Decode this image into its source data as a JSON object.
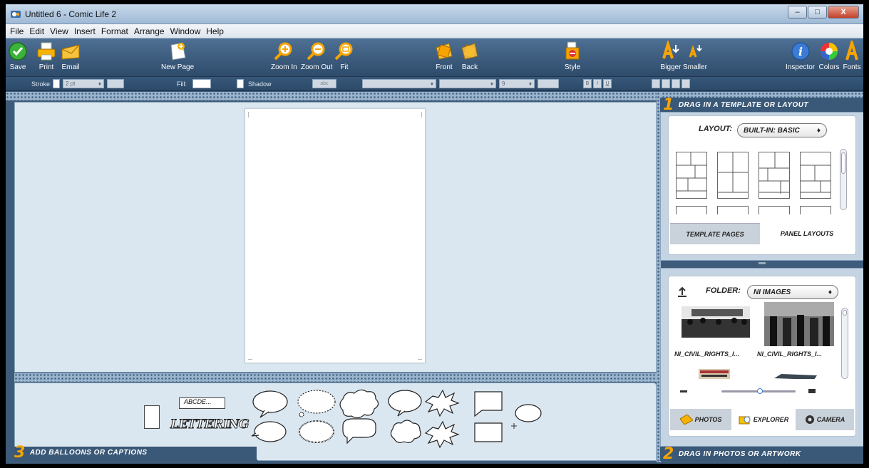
{
  "window": {
    "title": "Untitled 6 - Comic Life 2",
    "minimize": "–",
    "maximize": "□",
    "close": "X"
  },
  "menu": [
    "File",
    "Edit",
    "View",
    "Insert",
    "Format",
    "Arrange",
    "Window",
    "Help"
  ],
  "toolbar": {
    "save": "Save",
    "print": "Print",
    "email": "Email",
    "new_page": "New Page",
    "zoom_in": "Zoom In",
    "zoom_out": "Zoom Out",
    "fit": "Fit",
    "front": "Front",
    "back": "Back",
    "style": "Style",
    "bigger": "Bigger",
    "smaller": "Smaller",
    "inspector": "Inspector",
    "colors": "Colors",
    "fonts": "Fonts"
  },
  "formatbar": {
    "stroke_label": "Stroke:",
    "stroke_value": "2 pt",
    "fill_label": "Fill:",
    "shadow_label": "Shadow",
    "shadow_button": "abc",
    "font_size": "9",
    "bold": "B",
    "italic": "I",
    "underline": "U"
  },
  "panels": {
    "step1_number": "1",
    "step1_title": "DRAG IN A TEMPLATE OR LAYOUT",
    "step2_number": "2",
    "step2_title": "DRAG IN PHOTOS OR ARTWORK",
    "step3_number": "3",
    "step3_title": "ADD BALLOONS OR CAPTIONS"
  },
  "layout_panel": {
    "label": "LAYOUT:",
    "selected": "BUILT-IN: BASIC",
    "tabs": [
      "TEMPLATE PAGES",
      "PANEL LAYOUTS"
    ],
    "active_tab": "PANEL LAYOUTS"
  },
  "photos_panel": {
    "folder_label": "FOLDER:",
    "folder_selected": "NI IMAGES",
    "items": [
      "NI_CIVIL_RIGHTS_I...",
      "NI_CIVIL_RIGHTS_I..."
    ],
    "tabs": [
      "PHOTOS",
      "EXPLORER",
      "CAMERA"
    ],
    "active_tab": "EXPLORER"
  },
  "balloons": {
    "caption_text": "ABCDE...",
    "lettering_text": "LETTERING"
  },
  "colors": {
    "accent_orange": "#f6a400",
    "panel_blue": "#3a5877",
    "canvas_bg": "#dbe7f0"
  }
}
